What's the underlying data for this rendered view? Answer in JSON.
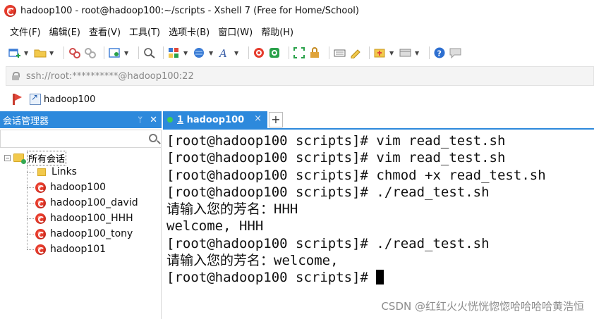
{
  "window": {
    "title": "hadoop100 - root@hadoop100:~/scripts - Xshell 7 (Free for Home/School)",
    "app_icon": "xshell-logo-icon"
  },
  "menu": {
    "items": [
      "文件(F)",
      "编辑(E)",
      "查看(V)",
      "工具(T)",
      "选项卡(B)",
      "窗口(W)",
      "帮助(H)"
    ]
  },
  "toolbar": {
    "icons": [
      "new-session-icon",
      "open-folder-icon",
      "connect-icon",
      "disconnect-icon",
      "properties-icon",
      "find-icon",
      "layout-icon",
      "globe-icon",
      "font-icon",
      "xshell-icon",
      "xftp-icon",
      "fullscreen-icon",
      "lock-icon",
      "keyboard-icon",
      "highlight-icon",
      "compose-icon",
      "tile-icon",
      "help-icon",
      "chat-icon"
    ]
  },
  "address": {
    "value": "ssh://root:**********@hadoop100:22"
  },
  "links": {
    "item_label": "hadoop100"
  },
  "session_manager": {
    "title": "会话管理器",
    "pin_glyph": "ᛘ",
    "close_glyph": "✕",
    "root_label": "所有会话",
    "items": [
      {
        "label": "Links",
        "type": "folder"
      },
      {
        "label": "hadoop100",
        "type": "session"
      },
      {
        "label": "hadoop100_david",
        "type": "session"
      },
      {
        "label": "hadoop100_HHH",
        "type": "session"
      },
      {
        "label": "hadoop100_tony",
        "type": "session"
      },
      {
        "label": "hadoop101",
        "type": "session"
      }
    ]
  },
  "tabs": {
    "active": {
      "number": "1",
      "label": " hadoop100"
    },
    "close_glyph": "×",
    "add_glyph": "+"
  },
  "terminal": {
    "lines": [
      "[root@hadoop100 scripts]# vim read_test.sh",
      "[root@hadoop100 scripts]# vim read_test.sh",
      "[root@hadoop100 scripts]# chmod +x read_test.sh",
      "[root@hadoop100 scripts]# ./read_test.sh",
      "请输入您的芳名：HHH",
      "welcome, HHH",
      "[root@hadoop100 scripts]# ./read_test.sh",
      "请输入您的芳名：welcome,",
      "[root@hadoop100 scripts]# "
    ]
  },
  "watermark": "CSDN @红红火火恍恍惚惚哈哈哈哈黄浩恒",
  "colors": {
    "accent": "#2d89dc",
    "tab_dot": "#3ecf56",
    "terminal_bg": "#ffffff",
    "terminal_fg": "#111111"
  }
}
